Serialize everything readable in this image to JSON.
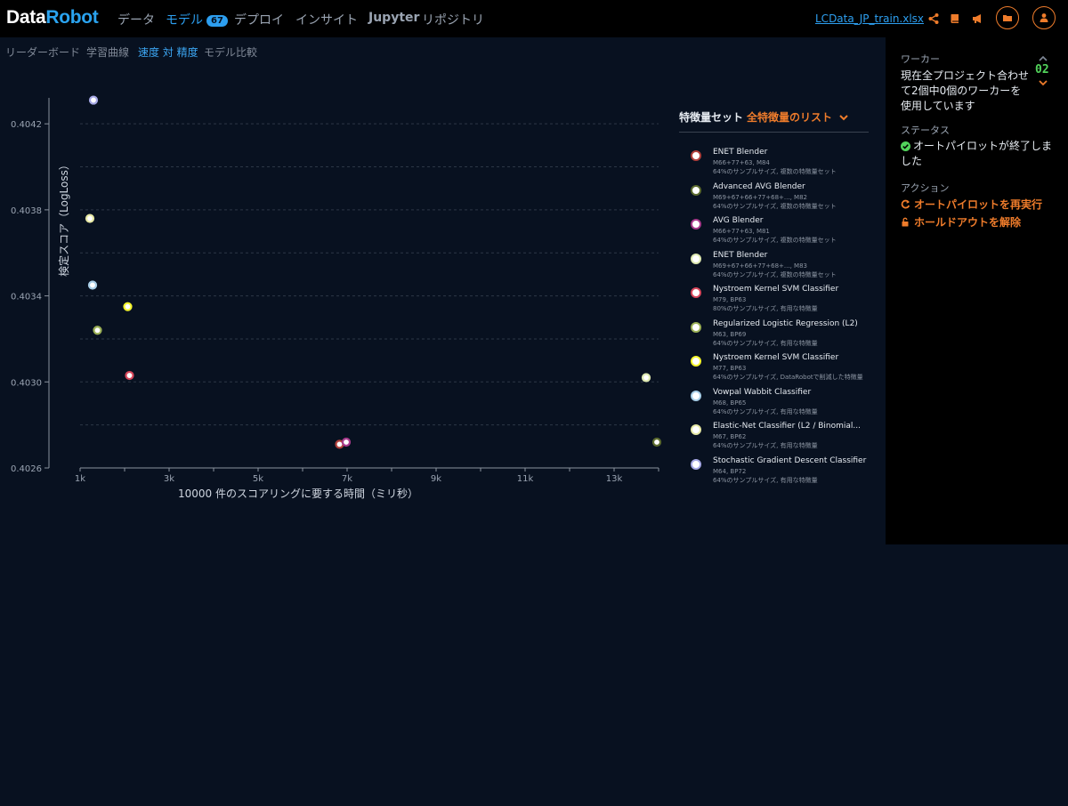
{
  "header": {
    "logo_part1": "Data",
    "logo_part2": "Robot",
    "nav": [
      {
        "label": "データ"
      },
      {
        "label": "モデル",
        "badge": "67"
      },
      {
        "label": "デプロイ"
      },
      {
        "label": "インサイト"
      },
      {
        "label": "Jupyter"
      },
      {
        "label": "リポジトリ"
      }
    ],
    "project_name": "LCData_JP_train.xlsx"
  },
  "subtabs": [
    "リーダーボード",
    "学習曲線",
    "速度 対 精度",
    "モデル比較"
  ],
  "sidebar": {
    "workers_label": "ワーカー",
    "workers_text": [
      "現在全プロジェクト合わせ",
      "て2個中0個のワーカーを",
      "使用しています"
    ],
    "workers_count": "02",
    "status_label": "ステータス",
    "status_text": [
      "オートパイロットが終了しま",
      "した"
    ],
    "actions_label": "アクション",
    "action_rerun": "オートパイロットを再実行",
    "action_unlock": "ホールドアウトを解除"
  },
  "legend": {
    "title": "特徴量セット",
    "dropdown": "全特徴量のリスト"
  },
  "chart_data": {
    "type": "scatter",
    "xlabel": "10000 件のスコアリングに要する時間（ミリ秒）",
    "ylabel": "検定スコア（LogLoss）",
    "xlim": [
      1000,
      14000
    ],
    "ylim": [
      0.4026,
      0.4043
    ],
    "x_ticks": [
      1000,
      3000,
      5000,
      7000,
      9000,
      11000,
      13000
    ],
    "x_tick_labels": [
      "1k",
      "3k",
      "5k",
      "7k",
      "9k",
      "11k",
      "13k"
    ],
    "y_ticks": [
      0.4026,
      0.403,
      0.4034,
      0.4038,
      0.4042
    ],
    "y_tick_labels": [
      "0.4026",
      "0.4030",
      "0.4034",
      "0.4038",
      "0.4042"
    ],
    "grid": true,
    "series": [
      {
        "name": "ENET Blender",
        "line2": "M66+77+63, M84",
        "line3": "64%のサンプルサイズ, 複数の特徴量セット",
        "color": "#b0403c",
        "x": 6830,
        "y": 0.40271
      },
      {
        "name": "Advanced AVG Blender",
        "line2": "M69+67+66+77+68+..., M82",
        "line3": "64%のサンプルサイズ, 複数の特徴量セット",
        "color": "#5c6b2e",
        "x": 13960,
        "y": 0.40272
      },
      {
        "name": "AVG Blender",
        "line2": "M66+77+63, M81",
        "line3": "64%のサンプルサイズ, 複数の特徴量セット",
        "color": "#a83a8c",
        "x": 6980,
        "y": 0.40272
      },
      {
        "name": "ENET Blender",
        "line2": "M69+67+66+77+68+..., M83",
        "line3": "64%のサンプルサイズ, 複数の特徴量セット",
        "color": "#dde8b0",
        "x": 13720,
        "y": 0.40302
      },
      {
        "name": "Nystroem Kernel SVM Classifier",
        "line2": "M79, BP63",
        "line3": "80%のサンプルサイズ, 有用な特徴量",
        "color": "#d7475b",
        "x": 2110,
        "y": 0.40303
      },
      {
        "name": "Regularized Logistic Regression (L2)",
        "line2": "M63, BP69",
        "line3": "64%のサンプルサイズ, 有用な特徴量",
        "color": "#9bb056",
        "x": 1390,
        "y": 0.40324
      },
      {
        "name": "Nystroem Kernel SVM Classifier",
        "line2": "M77, BP63",
        "line3": "64%のサンプルサイズ, DataRobotで削減した特徴量",
        "color": "#f5f52c",
        "x": 2070,
        "y": 0.40335
      },
      {
        "name": "Vowpal Wabbit Classifier",
        "line2": "M68, BP65",
        "line3": "64%のサンプルサイズ, 有用な特徴量",
        "color": "#a9cfe8",
        "x": 1280,
        "y": 0.40345
      },
      {
        "name": "Elastic-Net Classifier (L2 / Binomial...",
        "line2": "M67, BP62",
        "line3": "64%のサンプルサイズ, 有用な特徴量",
        "color": "#e6e8a4",
        "x": 1220,
        "y": 0.40376
      },
      {
        "name": "Stochastic Gradient Descent Classifier",
        "line2": "M64, BP72",
        "line3": "64%のサンプルサイズ, 有用な特徴量",
        "color": "#a7a9e6",
        "x": 1300,
        "y": 0.40431
      }
    ]
  }
}
